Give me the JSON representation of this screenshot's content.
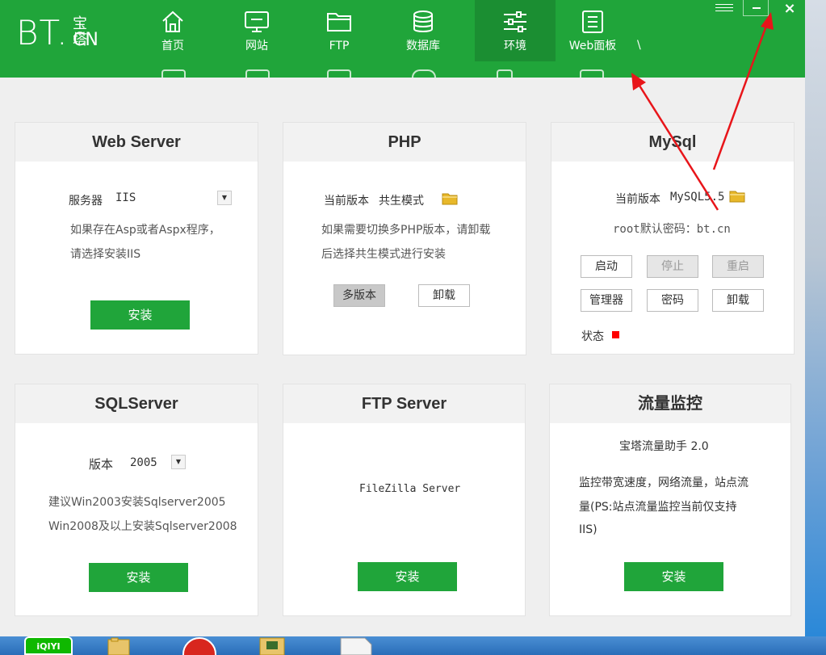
{
  "window": {
    "logo": {
      "main": "BT.",
      "cn_top": "宝塔",
      "cn_bottom": "CN"
    },
    "tabs": [
      {
        "label": "首页",
        "icon": "home-icon"
      },
      {
        "label": "网站",
        "icon": "monitor-icon"
      },
      {
        "label": "FTP",
        "icon": "folder-icon"
      },
      {
        "label": "数据库",
        "icon": "database-icon"
      },
      {
        "label": "环境",
        "icon": "sliders-icon",
        "active": true
      },
      {
        "label": "Web面板",
        "icon": "list-icon"
      }
    ],
    "tab_overflow": "\\",
    "controls": {
      "menu": "menu-icon",
      "minimize": "minimize-icon",
      "close": "×"
    }
  },
  "cards": {
    "webserver": {
      "title": "Web Server",
      "server_label": "服务器",
      "server_value": "IIS",
      "desc_line1": "如果存在Asp或者Aspx程序，",
      "desc_line2": "请选择安装IIS",
      "install": "安装"
    },
    "php": {
      "title": "PHP",
      "version_label": "当前版本",
      "version_value": "共生模式",
      "desc_line1": "如果需要切换多PHP版本，请卸载",
      "desc_line2": "后选择共生模式进行安装",
      "multi_version": "多版本",
      "uninstall": "卸载"
    },
    "mysql": {
      "title": "MySql",
      "version_label": "当前版本",
      "version_value": "MySQL5.5",
      "password_note": "root默认密码：bt.cn",
      "buttons": {
        "start": "启动",
        "stop": "停止",
        "restart": "重启",
        "manager": "管理器",
        "password": "密码",
        "uninstall": "卸载"
      },
      "status_label": "状态",
      "status_color": "#ff0000"
    },
    "sqlserver": {
      "title": "SQLServer",
      "version_label": "版本",
      "version_value": "2005",
      "desc_line1": "建议Win2003安装Sqlserver2005",
      "desc_line2": "Win2008及以上安装Sqlserver2008",
      "install": "安装"
    },
    "ftp": {
      "title": "FTP Server",
      "product": "FileZilla Server",
      "install": "安装"
    },
    "traffic": {
      "title": "流量监控",
      "product": "宝塔流量助手 2.0",
      "desc_line1": "监控带宽速度，网络流量，站点流",
      "desc_line2": "量(PS:站点流量监控当前仅支持",
      "desc_line3": "IIS)",
      "install": "安装"
    }
  },
  "colors": {
    "brand_green": "#20a53a",
    "active_tab": "#1b8e32",
    "annotation_red": "#e8151a"
  },
  "taskbar": {
    "items": [
      "iqiyi-icon",
      "folder-icon",
      "app-icon",
      "file-manager-icon",
      "document-icon"
    ],
    "iqiyi_text": "iQIYI"
  }
}
